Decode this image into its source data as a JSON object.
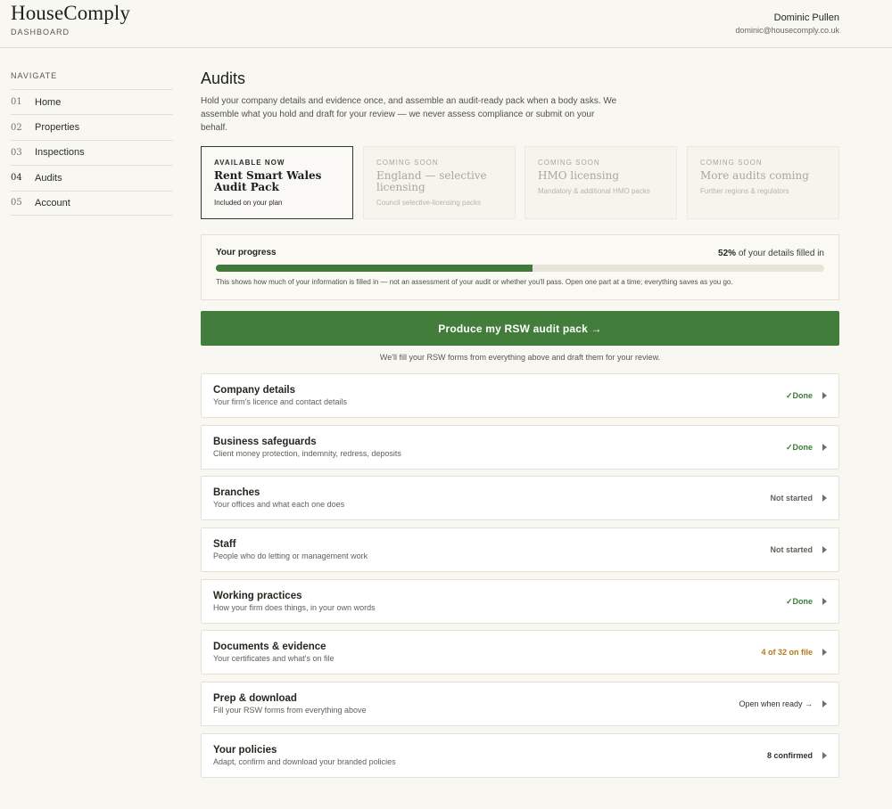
{
  "header": {
    "brand": "HouseComply",
    "section": "DASHBOARD",
    "user_name": "Dominic Pullen",
    "user_email": "dominic@housecomply.co.uk"
  },
  "sidebar": {
    "title": "NAVIGATE",
    "items": [
      {
        "num": "01",
        "label": "Home"
      },
      {
        "num": "02",
        "label": "Properties"
      },
      {
        "num": "03",
        "label": "Inspections"
      },
      {
        "num": "04",
        "label": "Audits",
        "active": true
      },
      {
        "num": "05",
        "label": "Account"
      }
    ]
  },
  "main": {
    "title": "Audits",
    "intro": "Hold your company details and evidence once, and assemble an audit-ready pack when a body asks. We assemble what you hold and draft for your review — we never assess compliance or submit on your behalf."
  },
  "cards": [
    {
      "tag": "AVAILABLE NOW",
      "title": "Rent Smart Wales Audit Pack",
      "sub": "Included on your plan",
      "active": true
    },
    {
      "tag": "COMING SOON",
      "title": "England — selective licensing",
      "sub": "Council selective-licensing packs",
      "active": false
    },
    {
      "tag": "COMING SOON",
      "title": "HMO licensing",
      "sub": "Mandatory & additional HMO packs",
      "active": false
    },
    {
      "tag": "COMING SOON",
      "title": "More audits coming",
      "sub": "Further regions & regulators",
      "active": false
    }
  ],
  "progress": {
    "label": "Your progress",
    "percent": 52,
    "percent_text": "52%",
    "percent_suffix": "of your details filled in",
    "note": "This shows how much of your information is filled in — not an assessment of your audit or whether you'll pass. Open one part at a time; everything saves as you go."
  },
  "produce": {
    "button_label": "Produce my RSW audit pack →",
    "note": "We'll fill your RSW forms from everything above and draft them for your review."
  },
  "sections": [
    {
      "title": "Company details",
      "sub": "Your firm's licence and contact details",
      "status": "✓Done",
      "kind": "done"
    },
    {
      "title": "Business safeguards",
      "sub": "Client money protection, indemnity, redress, deposits",
      "status": "✓Done",
      "kind": "done"
    },
    {
      "title": "Branches",
      "sub": "Your offices and what each one does",
      "status": "Not started",
      "kind": "todo"
    },
    {
      "title": "Staff",
      "sub": "People who do letting or management work",
      "status": "Not started",
      "kind": "todo"
    },
    {
      "title": "Working practices",
      "sub": "How your firm does things, in your own words",
      "status": "✓Done",
      "kind": "done"
    },
    {
      "title": "Documents & evidence",
      "sub": "Your certificates and what's on file",
      "status": "4 of 32 on file",
      "kind": "warn"
    },
    {
      "title": "Prep & download",
      "sub": "Fill your RSW forms from everything above",
      "status": "Open when ready →",
      "kind": "plain"
    },
    {
      "title": "Your policies",
      "sub": "Adapt, confirm and download your branded policies",
      "status": "8 confirmed",
      "kind": "todo"
    }
  ],
  "colors": {
    "accent": "#427d3c",
    "done": "#3d7a37",
    "warn": "#b37a1c",
    "background": "#f8f7f1"
  }
}
